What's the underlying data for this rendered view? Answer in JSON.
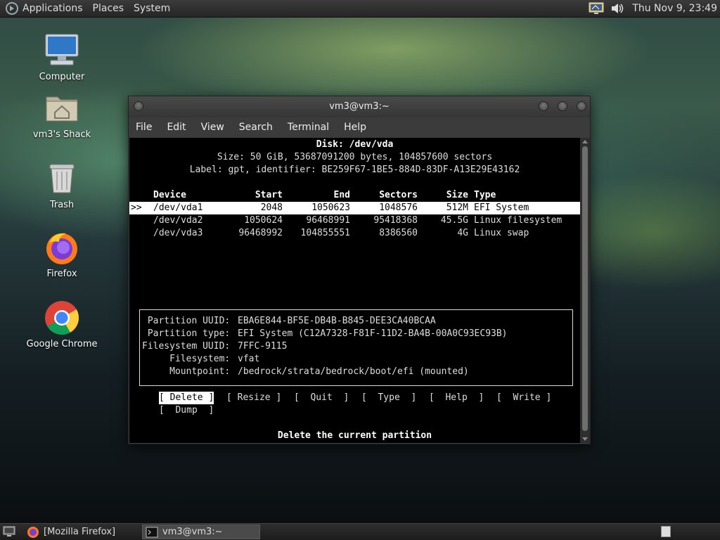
{
  "top_panel": {
    "menus": [
      "Applications",
      "Places",
      "System"
    ],
    "clock": "Thu Nov 9, 23:49",
    "tray_icons": [
      "display-icon",
      "volume-icon"
    ]
  },
  "desktop_icons": [
    {
      "label": "Computer",
      "icon": "computer-icon"
    },
    {
      "label": "vm3's Shack",
      "icon": "home-folder-icon"
    },
    {
      "label": "Trash",
      "icon": "trash-icon"
    },
    {
      "label": "Firefox",
      "icon": "firefox-icon"
    },
    {
      "label": "Google Chrome",
      "icon": "chrome-icon"
    }
  ],
  "window": {
    "title": "vm3@vm3:~",
    "menu": [
      "File",
      "Edit",
      "View",
      "Search",
      "Terminal",
      "Help"
    ]
  },
  "cfdisk": {
    "disk_line": "Disk: /dev/vda",
    "size_line": "Size: 50 GiB, 53687091200 bytes, 104857600 sectors",
    "label_line": "Label: gpt, identifier: BE259F67-1BE5-884D-83DF-A13E29E43162",
    "headers": {
      "device": "Device",
      "start": "Start",
      "end": "End",
      "sectors": "Sectors",
      "size": "Size",
      "type": "Type"
    },
    "selector": ">>",
    "partitions": [
      {
        "device": "/dev/vda1",
        "start": "2048",
        "end": "1050623",
        "sectors": "1048576",
        "size": "512M",
        "type": "EFI System"
      },
      {
        "device": "/dev/vda2",
        "start": "1050624",
        "end": "96468991",
        "sectors": "95418368",
        "size": "45.5G",
        "type": "Linux filesystem"
      },
      {
        "device": "/dev/vda3",
        "start": "96468992",
        "end": "104855551",
        "sectors": "8386560",
        "size": "4G",
        "type": "Linux swap"
      }
    ],
    "info": [
      {
        "label": " Partition UUID:",
        "value": "EBA6E844-BF5E-DB4B-B845-DEE3CA40BCAA"
      },
      {
        "label": " Partition type:",
        "value": "EFI System (C12A7328-F81F-11D2-BA4B-00A0C93EC93B)"
      },
      {
        "label": "Filesystem UUID:",
        "value": "7FFC-9115"
      },
      {
        "label": "     Filesystem:",
        "value": "vfat"
      },
      {
        "label": "     Mountpoint:",
        "value": "/bedrock/strata/bedrock/boot/efi (mounted)"
      }
    ],
    "buttons": [
      "[ Delete ]",
      "[ Resize ]",
      "[  Quit  ]",
      "[  Type  ]",
      "[  Help  ]",
      "[  Write ]",
      "[  Dump  ]"
    ],
    "status": "Delete the current partition"
  },
  "taskbar": {
    "tasks": [
      "[Mozilla Firefox]",
      "vm3@vm3:~"
    ]
  }
}
